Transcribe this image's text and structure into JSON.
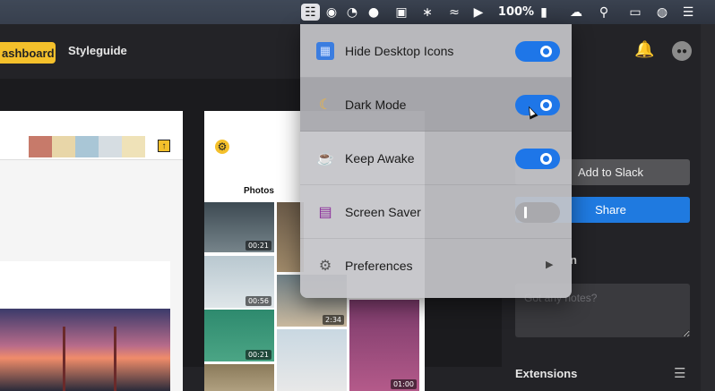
{
  "menubar": {
    "battery_percent": "100%",
    "icons": [
      "one-switch-icon",
      "record-icon",
      "gauge-icon",
      "tomato-icon",
      "display-icon",
      "bluetooth-icon",
      "wifi-icon",
      "volume-icon",
      "battery-icon",
      "creative-cloud-icon",
      "search-icon",
      "airplay-icon",
      "siri-icon",
      "list-icon"
    ]
  },
  "app": {
    "tabs": [
      {
        "label": "ashboard",
        "active": true
      },
      {
        "label": "Styleguide",
        "active": false
      }
    ],
    "accent": "#f4c02b"
  },
  "artboard": {
    "photos_title": "Photos",
    "durations": [
      "00:21",
      "00:56",
      "2:34",
      "00:21",
      "01:00"
    ]
  },
  "right_panel": {
    "add_to_slack": "Add to Slack",
    "share": "Share",
    "section_label": "n",
    "notes_placeholder": "Got any notes?",
    "extensions": "Extensions"
  },
  "menu": {
    "items": [
      {
        "label": "Hide Desktop Icons",
        "icon": "grid-icon",
        "toggle": "on"
      },
      {
        "label": "Dark Mode",
        "icon": "moon-icon",
        "toggle": "on"
      },
      {
        "label": "Keep Awake",
        "icon": "coffee-cup-icon",
        "toggle": "on"
      },
      {
        "label": "Screen Saver",
        "icon": "monitor-icon",
        "toggle": "off"
      },
      {
        "label": "Preferences",
        "icon": "gear-icon",
        "submenu": true
      }
    ]
  }
}
